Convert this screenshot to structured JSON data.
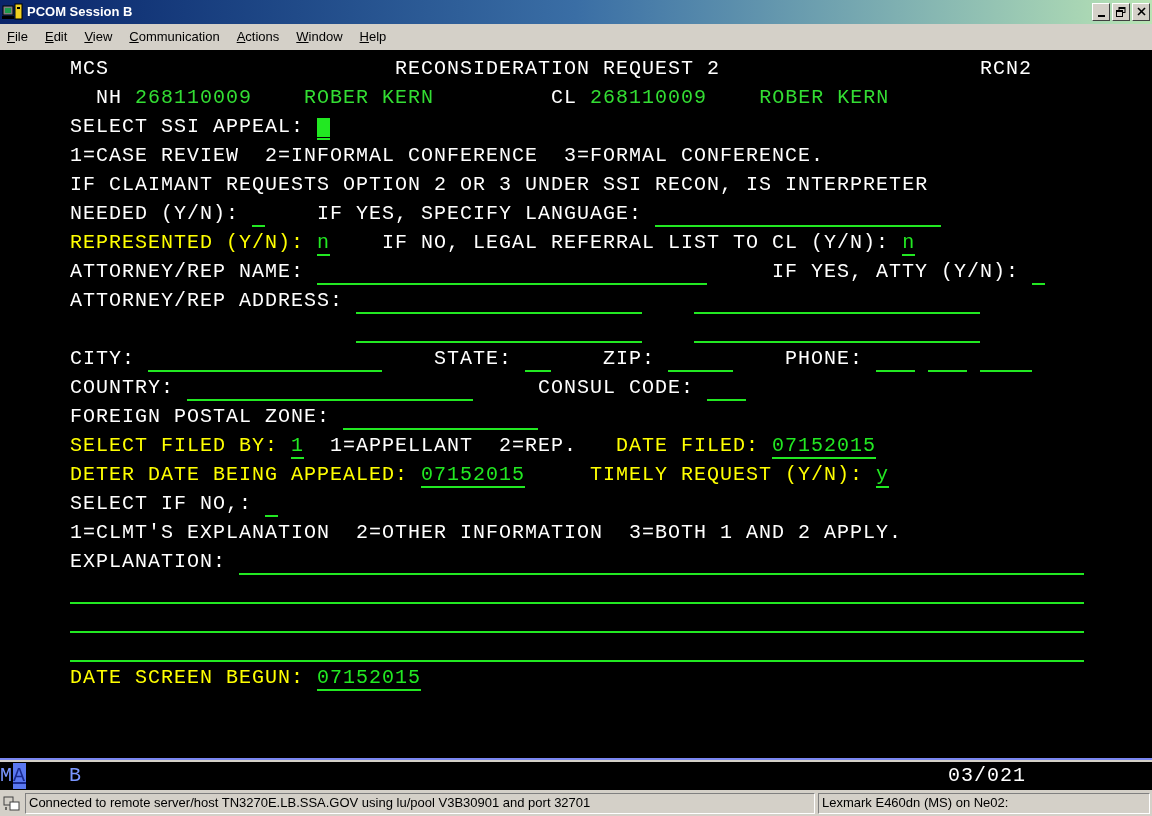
{
  "window": {
    "title": "PCOM Session B"
  },
  "menu": [
    {
      "label": "File"
    },
    {
      "label": "Edit"
    },
    {
      "label": "View"
    },
    {
      "label": "Communication"
    },
    {
      "label": "Actions"
    },
    {
      "label": "Window"
    },
    {
      "label": "Help"
    }
  ],
  "terminal": {
    "lines": [
      {
        "segments": [
          {
            "kind": "label",
            "text": "MCS",
            "color": "#ffffff"
          },
          {
            "kind": "label",
            "text": "RECONSIDERATION REQUEST 2",
            "color": "#ffffff"
          },
          {
            "kind": "label",
            "text": "RCN2",
            "color": "#ffffff"
          }
        ]
      },
      {
        "segments": [
          {
            "kind": "label",
            "text": "NH",
            "color": "#ffffff"
          },
          {
            "kind": "label",
            "text": "268110009",
            "color": "#33dd33"
          },
          {
            "kind": "label",
            "text": "ROBER KERN",
            "color": "#33dd33"
          },
          {
            "kind": "label",
            "text": "CL",
            "color": "#ffffff"
          },
          {
            "kind": "label",
            "text": "268110009",
            "color": "#33dd33"
          },
          {
            "kind": "label",
            "text": "ROBER KERN",
            "color": "#33dd33"
          }
        ]
      },
      {
        "segments": [
          {
            "kind": "label",
            "text": "SELECT SSI APPEAL:",
            "color": "#ffffff"
          },
          {
            "kind": "field",
            "cursor": true
          }
        ]
      },
      {
        "segments": [
          {
            "kind": "label",
            "text": "1=CASE REVIEW  2=INFORMAL CONFERENCE  3=FORMAL CONFERENCE.",
            "color": "#ffffff"
          }
        ]
      },
      {
        "segments": [
          {
            "kind": "label",
            "text": "IF CLAIMANT REQUESTS OPTION 2 OR 3 UNDER SSI RECON, IS INTERPRETER",
            "color": "#ffffff"
          }
        ]
      },
      {
        "segments": [
          {
            "kind": "label",
            "text": "NEEDED (Y/N):",
            "color": "#ffffff"
          },
          {
            "kind": "field",
            "cursor": false
          },
          {
            "kind": "label",
            "text": "IF YES, SPECIFY LANGUAGE:",
            "color": "#ffffff"
          },
          {
            "kind": "field",
            "cursor": false
          }
        ]
      },
      {
        "segments": [
          {
            "kind": "label",
            "text": "REPRESENTED (Y/N):",
            "color": "#ffff00"
          },
          {
            "kind": "field",
            "value": "n",
            "cursor": false
          },
          {
            "kind": "label",
            "text": "IF NO, LEGAL REFERRAL LIST TO CL (Y/N):",
            "color": "#ffffff"
          },
          {
            "kind": "field",
            "value": "n",
            "cursor": false
          }
        ]
      },
      {
        "segments": [
          {
            "kind": "label",
            "text": "ATTORNEY/REP NAME:",
            "color": "#ffffff"
          },
          {
            "kind": "field",
            "cursor": false
          },
          {
            "kind": "label",
            "text": "IF YES, ATTY (Y/N):",
            "color": "#ffffff"
          },
          {
            "kind": "field",
            "cursor": false
          }
        ]
      },
      {
        "segments": [
          {
            "kind": "label",
            "text": "ATTORNEY/REP ADDRESS:",
            "color": "#ffffff"
          },
          {
            "kind": "field",
            "cursor": false
          },
          {
            "kind": "field",
            "cursor": false
          }
        ]
      },
      {
        "segments": [
          {
            "kind": "field",
            "cursor": false
          },
          {
            "kind": "field",
            "cursor": false
          }
        ]
      },
      {
        "segments": [
          {
            "kind": "label",
            "text": "CITY:",
            "color": "#ffffff"
          },
          {
            "kind": "field",
            "cursor": false
          },
          {
            "kind": "label",
            "text": "STATE:",
            "color": "#ffffff"
          },
          {
            "kind": "field",
            "cursor": false
          },
          {
            "kind": "label",
            "text": "ZIP:",
            "color": "#ffffff"
          },
          {
            "kind": "field",
            "cursor": false
          },
          {
            "kind": "label",
            "text": "PHONE:",
            "color": "#ffffff"
          },
          {
            "kind": "field",
            "cursor": false
          },
          {
            "kind": "field",
            "cursor": false
          },
          {
            "kind": "field",
            "cursor": false
          }
        ]
      },
      {
        "segments": [
          {
            "kind": "label",
            "text": "COUNTRY:",
            "color": "#ffffff"
          },
          {
            "kind": "field",
            "cursor": false
          },
          {
            "kind": "label",
            "text": "CONSUL CODE:",
            "color": "#ffffff"
          },
          {
            "kind": "field",
            "cursor": false
          }
        ]
      },
      {
        "segments": [
          {
            "kind": "label",
            "text": "FOREIGN POSTAL ZONE:",
            "color": "#ffffff"
          },
          {
            "kind": "field",
            "cursor": false
          }
        ]
      },
      {
        "segments": [
          {
            "kind": "label",
            "text": "SELECT FILED BY:",
            "color": "#ffff00"
          },
          {
            "kind": "field",
            "value": "1",
            "cursor": false
          },
          {
            "kind": "label",
            "text": "1=APPELLANT  2=REP.",
            "color": "#ffffff"
          },
          {
            "kind": "label",
            "text": "DATE FILED:",
            "color": "#ffff00"
          },
          {
            "kind": "field",
            "value": "07152015",
            "cursor": false
          }
        ]
      },
      {
        "segments": [
          {
            "kind": "label",
            "text": "DETER DATE BEING APPEALED:",
            "color": "#ffff00"
          },
          {
            "kind": "field",
            "value": "07152015",
            "cursor": false
          },
          {
            "kind": "label",
            "text": "TIMELY REQUEST (Y/N):",
            "color": "#ffff00"
          },
          {
            "kind": "field",
            "value": "y",
            "cursor": false
          }
        ]
      },
      {
        "segments": [
          {
            "kind": "label",
            "text": "SELECT IF NO,:",
            "color": "#ffffff"
          },
          {
            "kind": "field",
            "cursor": false
          }
        ]
      },
      {
        "segments": [
          {
            "kind": "label",
            "text": "1=CLMT'S EXPLANATION  2=OTHER INFORMATION  3=BOTH 1 AND 2 APPLY.",
            "color": "#ffffff"
          }
        ]
      },
      {
        "segments": [
          {
            "kind": "label",
            "text": "EXPLANATION:",
            "color": "#ffffff"
          },
          {
            "kind": "field",
            "cursor": false
          }
        ]
      },
      {
        "segments": [
          {
            "kind": "field",
            "cursor": false
          }
        ]
      },
      {
        "segments": [
          {
            "kind": "field",
            "cursor": false
          }
        ]
      },
      {
        "segments": [
          {
            "kind": "field",
            "cursor": false
          }
        ]
      },
      {
        "segments": [
          {
            "kind": "label",
            "text": "DATE SCREEN BEGUN:",
            "color": "#ffff00"
          },
          {
            "kind": "field",
            "value": "07152015",
            "cursor": false
          }
        ]
      }
    ]
  },
  "oia": {
    "mode": "M",
    "cursor_char": "A",
    "session": "B",
    "position": "03/021"
  },
  "status_bar": {
    "connection": "Connected to remote server/host TN3270E.LB.SSA.GOV using lu/pool V3B30901 and port 32701",
    "printer": "Lexmark E460dn (MS) on Ne02:"
  }
}
